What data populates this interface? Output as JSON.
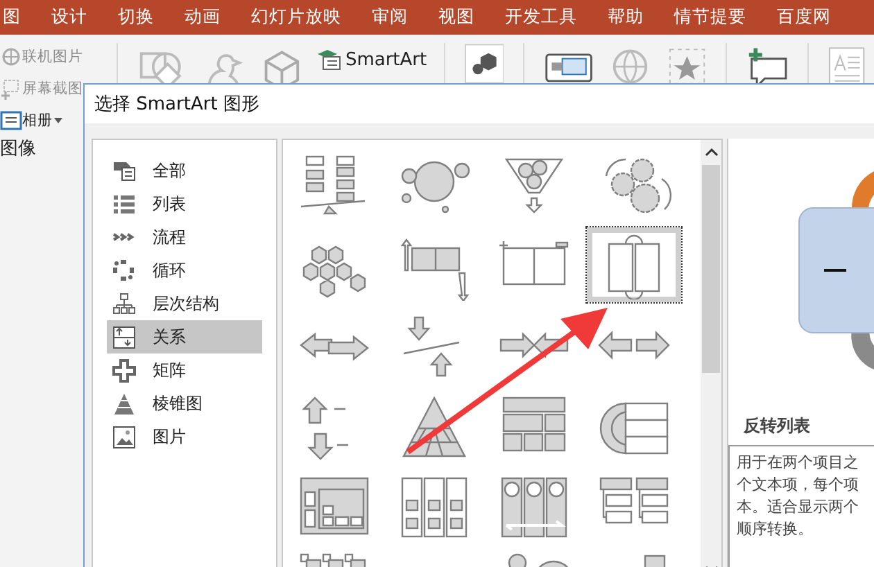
{
  "ribbon": {
    "tabs": [
      {
        "label": "图"
      },
      {
        "label": "设计"
      },
      {
        "label": "切换"
      },
      {
        "label": "动画"
      },
      {
        "label": "幻灯片放映"
      },
      {
        "label": "审阅"
      },
      {
        "label": "视图"
      },
      {
        "label": "开发工具"
      },
      {
        "label": "帮助"
      },
      {
        "label": "情节提要"
      },
      {
        "label": "百度网"
      }
    ],
    "image_commands": [
      {
        "label": "联机图片",
        "disabled": true,
        "kind": "online"
      },
      {
        "label": "屏幕截图",
        "disabled": true,
        "kind": "screenshot"
      },
      {
        "label": "相册",
        "disabled": false,
        "kind": "album"
      }
    ],
    "group_label": "图像",
    "smartart_button": {
      "label": "SmartArt"
    }
  },
  "dialog": {
    "title": "选择 SmartArt 图形",
    "categories": [
      {
        "label": "全部",
        "kind": "all",
        "selected": false
      },
      {
        "label": "列表",
        "kind": "list",
        "selected": false
      },
      {
        "label": "流程",
        "kind": "process",
        "selected": false
      },
      {
        "label": "循环",
        "kind": "cycle",
        "selected": false
      },
      {
        "label": "层次结构",
        "kind": "hierarchy",
        "selected": false
      },
      {
        "label": "关系",
        "kind": "relationship",
        "selected": true
      },
      {
        "label": "矩阵",
        "kind": "matrix",
        "selected": false
      },
      {
        "label": "棱锥图",
        "kind": "pyramid",
        "selected": false
      },
      {
        "label": "图片",
        "kind": "picture",
        "selected": false
      }
    ],
    "layouts": [
      {
        "kind": "balance",
        "selected": false
      },
      {
        "kind": "circles",
        "selected": false
      },
      {
        "kind": "funnel",
        "selected": false
      },
      {
        "kind": "gears",
        "selected": false
      },
      {
        "kind": "hexagons",
        "selected": false
      },
      {
        "kind": "arrow-box",
        "selected": false
      },
      {
        "kind": "plus-minus",
        "selected": false
      },
      {
        "kind": "reverse",
        "selected": true
      },
      {
        "kind": "opposing",
        "selected": false
      },
      {
        "kind": "counterbalance",
        "selected": false
      },
      {
        "kind": "converge",
        "selected": false
      },
      {
        "kind": "diverge",
        "selected": false
      },
      {
        "kind": "up-down",
        "selected": false
      },
      {
        "kind": "pyramid",
        "selected": false
      },
      {
        "kind": "table",
        "selected": false
      },
      {
        "kind": "nested",
        "selected": false
      },
      {
        "kind": "container",
        "selected": false
      },
      {
        "kind": "columns",
        "selected": false
      },
      {
        "kind": "circle-columns",
        "selected": false
      },
      {
        "kind": "boxes",
        "selected": false
      },
      {
        "kind": "tree",
        "selected": false
      },
      {
        "kind": "blank"
      },
      {
        "kind": "bubble",
        "selected": false
      },
      {
        "kind": "bar",
        "selected": false
      }
    ],
    "preview": {
      "title": "反转列表",
      "description": [
        "用于在两个项目之",
        "个文本项，每个项",
        "本。适合显示两个",
        "顺序转换。"
      ]
    }
  }
}
